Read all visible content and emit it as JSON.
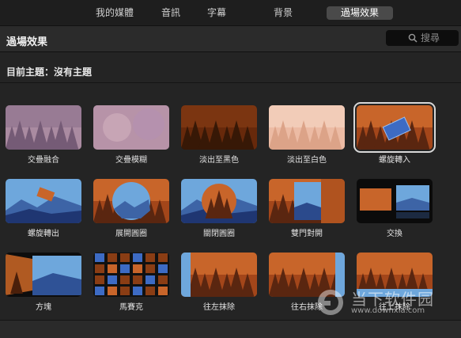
{
  "tabs": [
    "我的媒體",
    "音訊",
    "字幕",
    "背景",
    "過場效果"
  ],
  "active_tab": "過場效果",
  "header": {
    "title": "過場效果",
    "search_placeholder": "搜尋"
  },
  "theme_label": "目前主題：沒有主題",
  "transitions": [
    {
      "label": "交疊融合",
      "selected": false
    },
    {
      "label": "交疊模糊",
      "selected": false
    },
    {
      "label": "淡出至黑色",
      "selected": false
    },
    {
      "label": "淡出至白色",
      "selected": false
    },
    {
      "label": "螺旋轉入",
      "selected": true
    },
    {
      "label": "螺旋轉出",
      "selected": false
    },
    {
      "label": "展開圓圈",
      "selected": false
    },
    {
      "label": "關閉圓圈",
      "selected": false
    },
    {
      "label": "雙門對開",
      "selected": false
    },
    {
      "label": "交換",
      "selected": false
    },
    {
      "label": "方塊",
      "selected": false
    },
    {
      "label": "馬賽克",
      "selected": false
    },
    {
      "label": "往左抹除",
      "selected": false
    },
    {
      "label": "往右抹除",
      "selected": false
    },
    {
      "label": "往上抹除",
      "selected": false
    }
  ],
  "watermark": {
    "text": "当下软件园",
    "url": "www.downxia.com"
  },
  "colors": {
    "accent_selected_border": "#d8d8d8",
    "background": "#242424"
  }
}
